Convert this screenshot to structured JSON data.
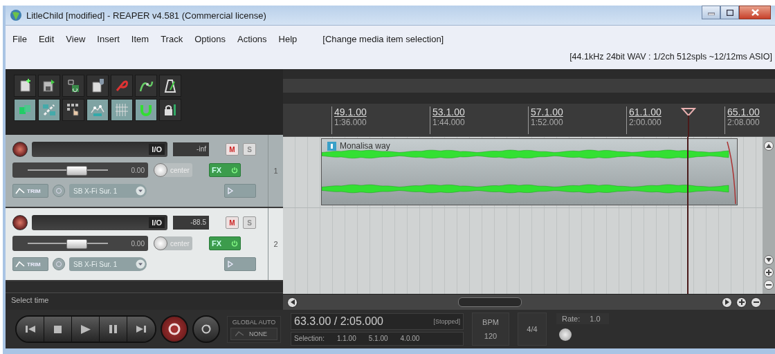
{
  "window": {
    "title": "LitleChild [modified] - REAPER v4.581 (Commercial license)"
  },
  "menu": {
    "items": [
      "File",
      "Edit",
      "View",
      "Insert",
      "Item",
      "Track",
      "Options",
      "Actions",
      "Help"
    ],
    "action_hint": "[Change media item selection]",
    "audio_info": "[44.1kHz 24bit WAV : 1/2ch 512spls ~12/12ms ASIO]"
  },
  "toolbar": {
    "toggles": [
      {
        "on": true
      },
      {
        "on": true
      },
      {
        "on": false
      },
      {
        "on": true
      },
      {
        "on": true
      },
      {
        "on": true
      },
      {
        "on": false
      }
    ]
  },
  "tracks": [
    {
      "number": "1",
      "selected": false,
      "io": "I/O",
      "volume_readout": "-inf",
      "mute": "M",
      "solo": "S",
      "volume": "0.00",
      "level": 0.6,
      "pan": "center",
      "fx": "FX",
      "trim": "TRIM",
      "input": "SB X-Fi Sur. 1"
    },
    {
      "number": "2",
      "selected": true,
      "io": "I/O",
      "volume_readout": "-88.5",
      "mute": "M",
      "solo": "S",
      "volume": "0.00",
      "level": 0.6,
      "pan": "center",
      "fx": "FX",
      "trim": "TRIM",
      "input": "SB X-Fi Sur. 1"
    }
  ],
  "ruler": {
    "marks": [
      {
        "bar": "49.1.00",
        "time": "1:36.000"
      },
      {
        "bar": "53.1.00",
        "time": "1:44.000"
      },
      {
        "bar": "57.1.00",
        "time": "1:52.000"
      },
      {
        "bar": "61.1.00",
        "time": "2:00.000"
      },
      {
        "bar": "65.1.00",
        "time": "2:08.000"
      }
    ]
  },
  "item": {
    "name": "Monalisa way"
  },
  "status": "Select time",
  "transport": {
    "global_auto": "GLOBAL AUTO",
    "auto_mode": "NONE",
    "position": "63.3.00 / 2:05.000",
    "state": "[Stopped]",
    "selection_label": "Selection:",
    "selection": [
      "1.1.00",
      "5.1.00",
      "4.0.00"
    ],
    "bpm_label": "BPM",
    "bpm": "120",
    "time_signature": "4/4",
    "rate_label": "Rate:",
    "rate": "1.0"
  }
}
